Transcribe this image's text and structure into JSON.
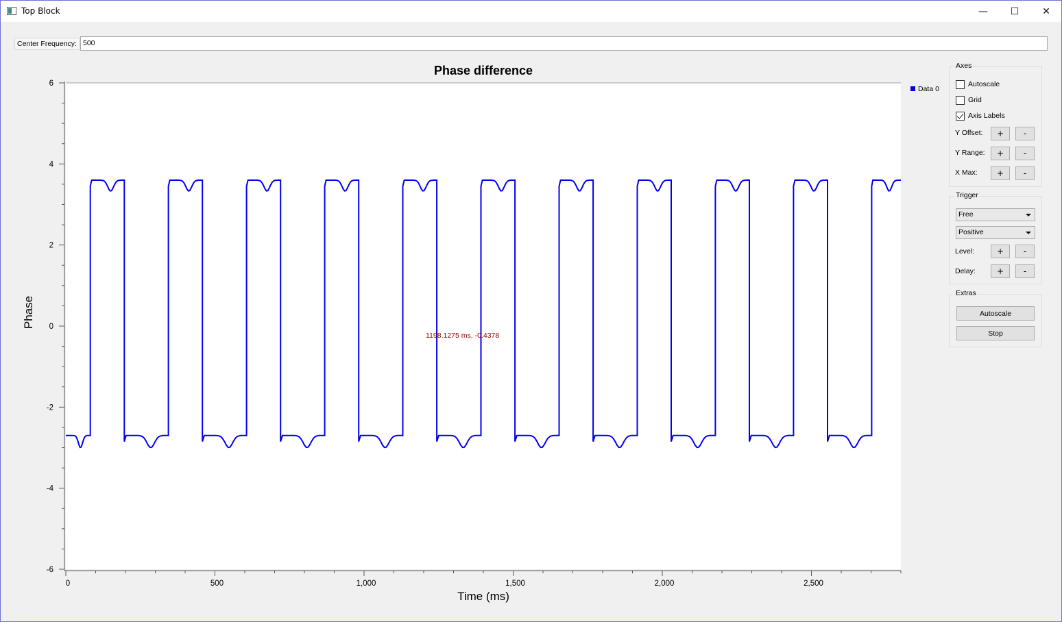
{
  "window": {
    "title": "Top Block",
    "minimize_glyph": "—",
    "maximize_glyph": "☐",
    "close_glyph": "✕",
    "border_color": "#6f6fd4"
  },
  "freq": {
    "label": "Center Frequency:",
    "value": "500"
  },
  "axes_panel": {
    "title": "Axes",
    "autoscale_label": "Autoscale",
    "autoscale_checked": false,
    "grid_label": "Grid",
    "grid_checked": false,
    "axis_labels_label": "Axis Labels",
    "axis_labels_checked": true,
    "y_offset_label": "Y Offset:",
    "y_range_label": "Y Range:",
    "x_max_label": "X Max:",
    "plus": "+",
    "minus": "-"
  },
  "trigger_panel": {
    "title": "Trigger",
    "mode": "Free",
    "slope": "Positive",
    "level_label": "Level:",
    "delay_label": "Delay:"
  },
  "extras_panel": {
    "title": "Extras",
    "autoscale_button": "Autoscale",
    "stop_button": "Stop"
  },
  "chart_data": {
    "type": "line",
    "title": "Phase difference",
    "xlabel": "Time (ms)",
    "ylabel": "Phase",
    "xlim": [
      0,
      2800
    ],
    "ylim": [
      -6,
      6
    ],
    "x_ticks": [
      0,
      500,
      1000,
      1500,
      2000,
      2500
    ],
    "x_tick_labels": [
      "0",
      "500",
      "1,000",
      "1,500",
      "2,000",
      "2,500"
    ],
    "y_ticks": [
      6,
      4,
      2,
      0,
      -2,
      -4,
      -6
    ],
    "y_tick_labels": [
      "6",
      "4",
      "2",
      "0",
      "-2",
      "-4",
      "-6"
    ],
    "grid": false,
    "legend_position": "top-right",
    "cursor_readout": "1198.1275 ms, -0.4378",
    "series": [
      {
        "name": "Data 0",
        "color": "#0000ee",
        "high_level": 3.6,
        "low_level": -2.7,
        "dip_high": 3.3,
        "dip_low": -3.0,
        "edges_ms": [
          82,
          196,
          344,
          458,
          606,
          720,
          868,
          982,
          1130,
          1244,
          1392,
          1506,
          1654,
          1768,
          1916,
          2030,
          2178,
          2292,
          2440,
          2554,
          2702,
          2800
        ]
      }
    ]
  }
}
